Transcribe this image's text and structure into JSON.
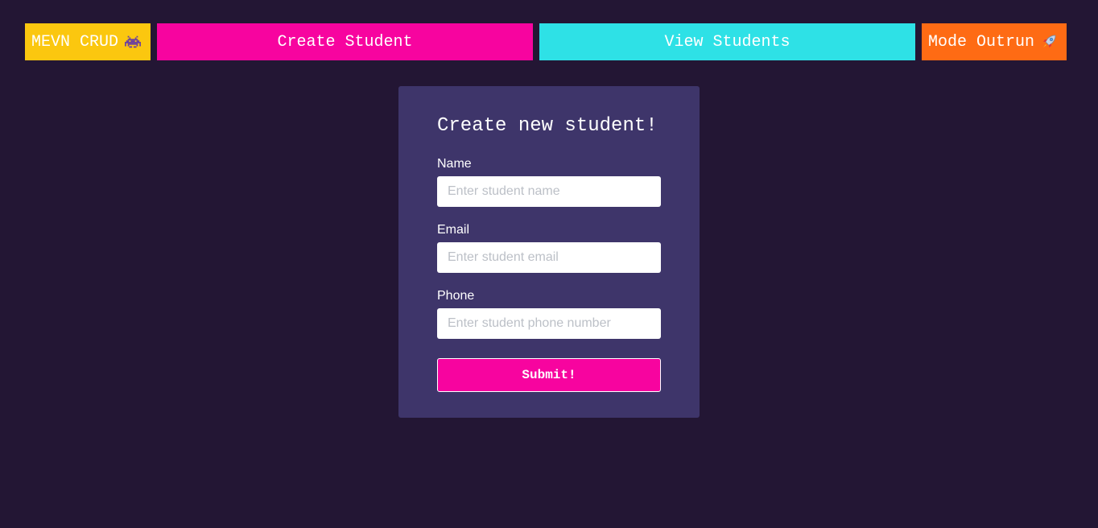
{
  "nav": {
    "brand_label": "MEVN CRUD",
    "brand_icon": "space-invader-icon",
    "create_label": "Create Student",
    "view_label": "View Students",
    "mode_label": "Mode Outrun",
    "mode_icon": "rocket-icon"
  },
  "form": {
    "title": "Create new student!",
    "fields": [
      {
        "label": "Name",
        "placeholder": "Enter student name",
        "value": ""
      },
      {
        "label": "Email",
        "placeholder": "Enter student email",
        "value": ""
      },
      {
        "label": "Phone",
        "placeholder": "Enter student phone number",
        "value": ""
      }
    ],
    "submit_label": "Submit!"
  },
  "colors": {
    "background": "#231634",
    "card": "#3e356a",
    "brand": "#fbc70f",
    "create": "#f7049f",
    "view": "#2ee1e6",
    "mode": "#fe6b14",
    "submit": "#f7049f"
  }
}
